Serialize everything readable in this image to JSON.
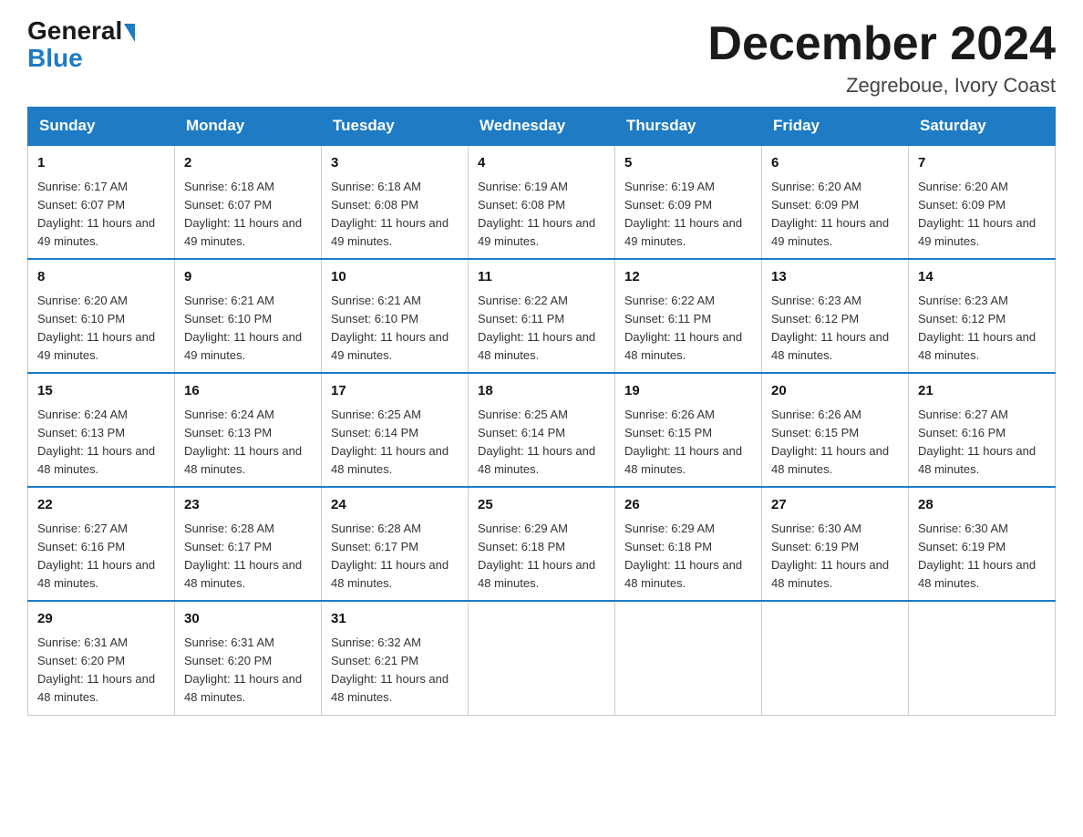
{
  "logo": {
    "general": "General",
    "blue": "Blue"
  },
  "header": {
    "month": "December 2024",
    "location": "Zegreboue, Ivory Coast"
  },
  "weekdays": [
    "Sunday",
    "Monday",
    "Tuesday",
    "Wednesday",
    "Thursday",
    "Friday",
    "Saturday"
  ],
  "weeks": [
    [
      {
        "day": "1",
        "sunrise": "6:17 AM",
        "sunset": "6:07 PM",
        "daylight": "11 hours and 49 minutes."
      },
      {
        "day": "2",
        "sunrise": "6:18 AM",
        "sunset": "6:07 PM",
        "daylight": "11 hours and 49 minutes."
      },
      {
        "day": "3",
        "sunrise": "6:18 AM",
        "sunset": "6:08 PM",
        "daylight": "11 hours and 49 minutes."
      },
      {
        "day": "4",
        "sunrise": "6:19 AM",
        "sunset": "6:08 PM",
        "daylight": "11 hours and 49 minutes."
      },
      {
        "day": "5",
        "sunrise": "6:19 AM",
        "sunset": "6:09 PM",
        "daylight": "11 hours and 49 minutes."
      },
      {
        "day": "6",
        "sunrise": "6:20 AM",
        "sunset": "6:09 PM",
        "daylight": "11 hours and 49 minutes."
      },
      {
        "day": "7",
        "sunrise": "6:20 AM",
        "sunset": "6:09 PM",
        "daylight": "11 hours and 49 minutes."
      }
    ],
    [
      {
        "day": "8",
        "sunrise": "6:20 AM",
        "sunset": "6:10 PM",
        "daylight": "11 hours and 49 minutes."
      },
      {
        "day": "9",
        "sunrise": "6:21 AM",
        "sunset": "6:10 PM",
        "daylight": "11 hours and 49 minutes."
      },
      {
        "day": "10",
        "sunrise": "6:21 AM",
        "sunset": "6:10 PM",
        "daylight": "11 hours and 49 minutes."
      },
      {
        "day": "11",
        "sunrise": "6:22 AM",
        "sunset": "6:11 PM",
        "daylight": "11 hours and 48 minutes."
      },
      {
        "day": "12",
        "sunrise": "6:22 AM",
        "sunset": "6:11 PM",
        "daylight": "11 hours and 48 minutes."
      },
      {
        "day": "13",
        "sunrise": "6:23 AM",
        "sunset": "6:12 PM",
        "daylight": "11 hours and 48 minutes."
      },
      {
        "day": "14",
        "sunrise": "6:23 AM",
        "sunset": "6:12 PM",
        "daylight": "11 hours and 48 minutes."
      }
    ],
    [
      {
        "day": "15",
        "sunrise": "6:24 AM",
        "sunset": "6:13 PM",
        "daylight": "11 hours and 48 minutes."
      },
      {
        "day": "16",
        "sunrise": "6:24 AM",
        "sunset": "6:13 PM",
        "daylight": "11 hours and 48 minutes."
      },
      {
        "day": "17",
        "sunrise": "6:25 AM",
        "sunset": "6:14 PM",
        "daylight": "11 hours and 48 minutes."
      },
      {
        "day": "18",
        "sunrise": "6:25 AM",
        "sunset": "6:14 PM",
        "daylight": "11 hours and 48 minutes."
      },
      {
        "day": "19",
        "sunrise": "6:26 AM",
        "sunset": "6:15 PM",
        "daylight": "11 hours and 48 minutes."
      },
      {
        "day": "20",
        "sunrise": "6:26 AM",
        "sunset": "6:15 PM",
        "daylight": "11 hours and 48 minutes."
      },
      {
        "day": "21",
        "sunrise": "6:27 AM",
        "sunset": "6:16 PM",
        "daylight": "11 hours and 48 minutes."
      }
    ],
    [
      {
        "day": "22",
        "sunrise": "6:27 AM",
        "sunset": "6:16 PM",
        "daylight": "11 hours and 48 minutes."
      },
      {
        "day": "23",
        "sunrise": "6:28 AM",
        "sunset": "6:17 PM",
        "daylight": "11 hours and 48 minutes."
      },
      {
        "day": "24",
        "sunrise": "6:28 AM",
        "sunset": "6:17 PM",
        "daylight": "11 hours and 48 minutes."
      },
      {
        "day": "25",
        "sunrise": "6:29 AM",
        "sunset": "6:18 PM",
        "daylight": "11 hours and 48 minutes."
      },
      {
        "day": "26",
        "sunrise": "6:29 AM",
        "sunset": "6:18 PM",
        "daylight": "11 hours and 48 minutes."
      },
      {
        "day": "27",
        "sunrise": "6:30 AM",
        "sunset": "6:19 PM",
        "daylight": "11 hours and 48 minutes."
      },
      {
        "day": "28",
        "sunrise": "6:30 AM",
        "sunset": "6:19 PM",
        "daylight": "11 hours and 48 minutes."
      }
    ],
    [
      {
        "day": "29",
        "sunrise": "6:31 AM",
        "sunset": "6:20 PM",
        "daylight": "11 hours and 48 minutes."
      },
      {
        "day": "30",
        "sunrise": "6:31 AM",
        "sunset": "6:20 PM",
        "daylight": "11 hours and 48 minutes."
      },
      {
        "day": "31",
        "sunrise": "6:32 AM",
        "sunset": "6:21 PM",
        "daylight": "11 hours and 48 minutes."
      },
      null,
      null,
      null,
      null
    ]
  ]
}
